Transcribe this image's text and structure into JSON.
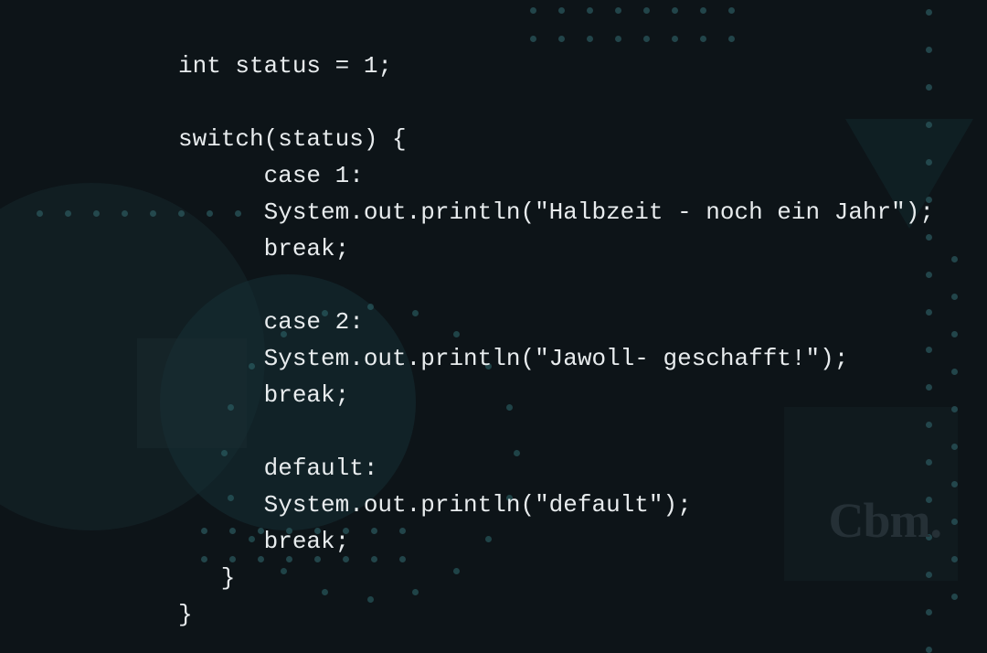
{
  "code": {
    "lines": [
      "int status = 1;",
      "",
      "switch(status) {",
      "      case 1:",
      "      System.out.println(\"Halbzeit - noch ein Jahr\");",
      "      break;",
      "",
      "      case 2:",
      "      System.out.println(\"Jawoll- geschafft!\");",
      "      break;",
      "",
      "      default:",
      "      System.out.println(\"default\");",
      "      break;",
      "   }",
      "}"
    ]
  },
  "watermark": "Cbm."
}
